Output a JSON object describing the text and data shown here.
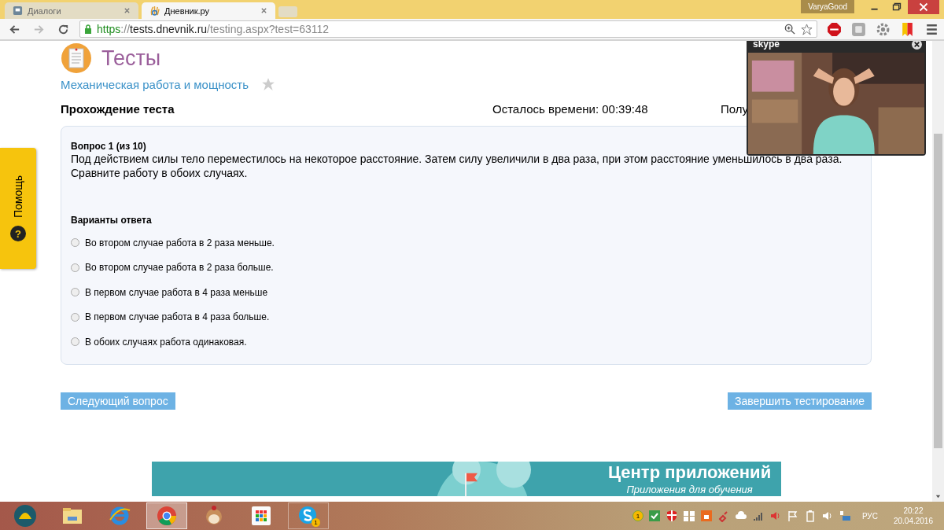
{
  "browser": {
    "tabs": [
      {
        "label": "Диалоги",
        "selected": false
      },
      {
        "label": "Дневник.ру",
        "selected": true
      }
    ],
    "profile": "VaryaGood",
    "url": {
      "scheme": "https",
      "separator": "://",
      "host": "tests.dnevnik.ru",
      "path": "/testing.aspx?test=63112"
    }
  },
  "page": {
    "title": "Тесты",
    "topic": "Механическая работа и мощность",
    "heading": "Прохождение теста",
    "timer": "Осталось времени: 00:39:48",
    "cut_label": "Полу",
    "question": {
      "number": "Вопрос 1 (из 10)",
      "text": "Под действием силы тело переместилось на некоторое расстояние. Затем силу увеличили в два раза, при этом расстояние уменьшилось в два раза. Сравните работу в обоих случаях.",
      "answers_label": "Варианты ответа",
      "answers": [
        {
          "label": "Во втором случае работа в 2 раза меньше.",
          "selected": false
        },
        {
          "label": "Во втором случае работа в 2 раза больше.",
          "selected": false
        },
        {
          "label": "В первом случае работа в 4 раза меньше",
          "selected": false
        },
        {
          "label": "В первом случае работа в 4 раза больше.",
          "selected": false
        },
        {
          "label": "В обоих случаях работа одинаковая.",
          "selected": false
        }
      ]
    },
    "buttons": {
      "next": "Следующий вопрос",
      "finish": "Завершить тестирование"
    },
    "banner": {
      "title": "Центр приложений",
      "subtitle": "Приложения для обучения"
    }
  },
  "help_tab": {
    "label": "Помощь",
    "icon": "?"
  },
  "skype": {
    "logo": "skype"
  },
  "taskbar": {
    "apps": [
      {
        "kind": "start",
        "selected": false
      },
      {
        "kind": "folder",
        "selected": false
      },
      {
        "kind": "ie",
        "selected": false
      },
      {
        "kind": "chrome",
        "selected": true
      },
      {
        "kind": "monkey",
        "selected": false
      },
      {
        "kind": "grid",
        "selected": false
      },
      {
        "kind": "skype",
        "selected": false,
        "badge": "1"
      }
    ],
    "tray_badge": "1",
    "language": "РУС",
    "time": "20:22",
    "date": "20.04.2016"
  }
}
